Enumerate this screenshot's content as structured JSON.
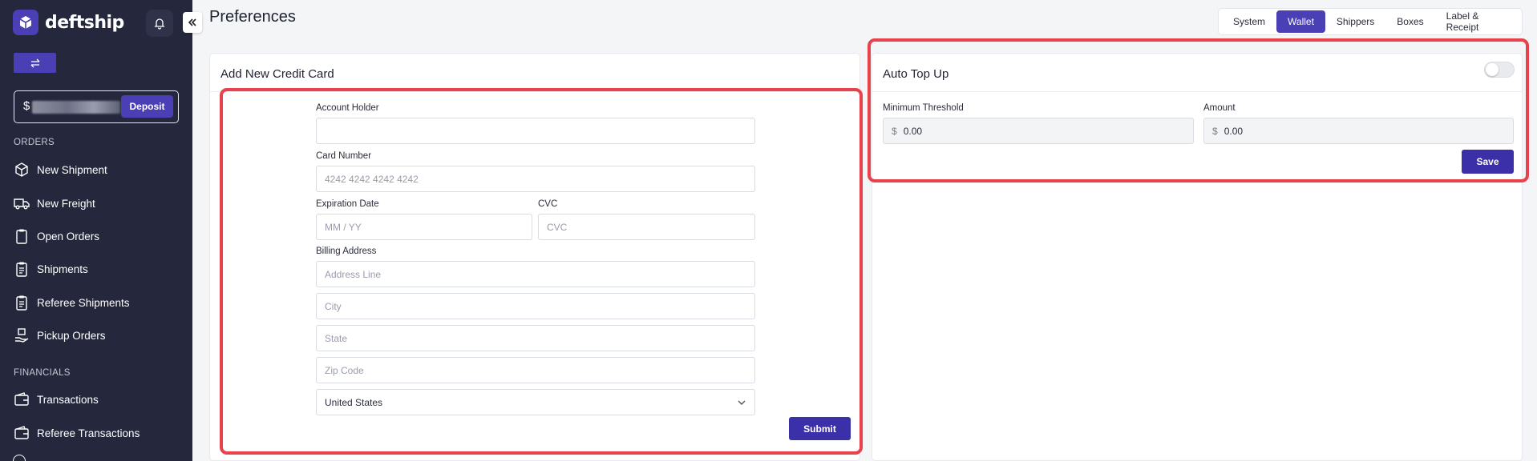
{
  "brand": {
    "name": "deftship"
  },
  "sidebar": {
    "balance_currency": "$",
    "deposit_label": "Deposit",
    "sections": [
      {
        "label": "ORDERS",
        "items": [
          {
            "label": "New Shipment",
            "icon": "box-icon"
          },
          {
            "label": "New Freight",
            "icon": "truck-icon"
          },
          {
            "label": "Open Orders",
            "icon": "clipboard-icon"
          },
          {
            "label": "Shipments",
            "icon": "clipboard-list-icon"
          },
          {
            "label": "Referee Shipments",
            "icon": "clipboard-list-icon"
          },
          {
            "label": "Pickup Orders",
            "icon": "hand-box-icon"
          }
        ]
      },
      {
        "label": "FINANCIALS",
        "items": [
          {
            "label": "Transactions",
            "icon": "wallet-icon"
          },
          {
            "label": "Referee Transactions",
            "icon": "wallet-icon"
          }
        ]
      }
    ]
  },
  "page": {
    "title": "Preferences"
  },
  "tabs": [
    {
      "label": "System",
      "active": false
    },
    {
      "label": "Wallet",
      "active": true
    },
    {
      "label": "Shippers",
      "active": false
    },
    {
      "label": "Boxes",
      "active": false
    },
    {
      "label": "Label & Receipt",
      "active": false
    }
  ],
  "credit_card": {
    "title": "Add New Credit Card",
    "account_holder_label": "Account Holder",
    "account_holder_value": "",
    "card_number_label": "Card Number",
    "card_number_placeholder": "4242 4242 4242 4242",
    "expiration_label": "Expiration Date",
    "expiration_placeholder": "MM / YY",
    "cvc_label": "CVC",
    "cvc_placeholder": "CVC",
    "billing_label": "Billing Address",
    "address_placeholder": "Address Line",
    "city_placeholder": "City",
    "state_placeholder": "State",
    "zip_placeholder": "Zip Code",
    "country_value": "United States",
    "submit_label": "Submit"
  },
  "auto_top_up": {
    "title": "Auto Top Up",
    "enabled": false,
    "min_threshold_label": "Minimum Threshold",
    "min_threshold_currency": "$",
    "min_threshold_value": "0.00",
    "amount_label": "Amount",
    "amount_currency": "$",
    "amount_value": "0.00",
    "save_label": "Save"
  },
  "colors": {
    "accent": "#4a3fb5",
    "sidebar_bg": "#25283d",
    "highlight": "#e8434d"
  }
}
